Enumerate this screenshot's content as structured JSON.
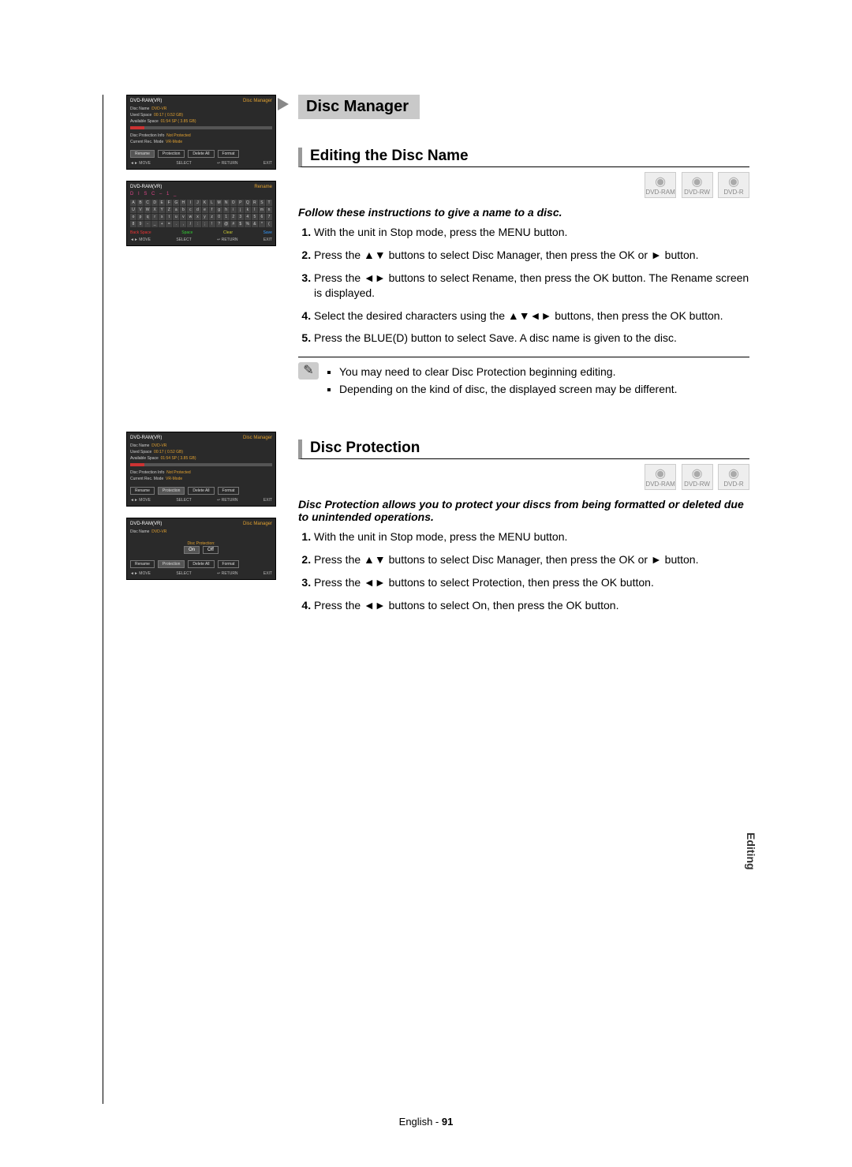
{
  "chapter": "Disc Manager",
  "side_tab": "Editing",
  "icons": {
    "ram": "DVD-RAM",
    "rw": "DVD-RW",
    "r": "DVD-R"
  },
  "section1": {
    "title": "Editing the Disc Name",
    "lead": "Follow these instructions to give a name to a disc.",
    "steps": [
      "With the unit in Stop mode, press the MENU button.",
      "Press the ▲▼ buttons to select Disc Manager, then press the OK or ► button.",
      "Press the ◄► buttons to select Rename, then press the OK button. The Rename screen is displayed.",
      "Select the desired characters using the ▲▼◄► buttons, then press the OK button.",
      "Press the BLUE(D) button to select Save. A disc name is given to the disc."
    ],
    "notes": [
      "You may need to clear Disc Protection beginning editing.",
      "Depending on the kind of disc, the displayed screen may be different."
    ]
  },
  "section2": {
    "title": "Disc Protection",
    "lead": "Disc Protection allows you to protect your discs from being formatted or deleted due to unintended operations.",
    "steps": [
      "With the unit in Stop mode, press the MENU button.",
      "Press the ▲▼ buttons to select Disc Manager, then press the OK or ► button.",
      "Press the ◄► buttons to select Protection, then press the OK button.",
      "Press the ◄► buttons to select On, then press the OK button."
    ]
  },
  "osd": {
    "model": "DVD-RAM(VR)",
    "dm": "Disc Manager",
    "rename": "Rename",
    "disc_name_k": "Disc Name",
    "disc_name_v": "DVD-VR",
    "used_k": "Used Space",
    "used_v": "00:17  ( 0.52 GB)",
    "avail_k": "Available Space",
    "avail_v": "01:54 SP  ( 3.85 GB)",
    "prot_k": "Disc Protection Info",
    "prot_v": "Not Protected",
    "mode_k": "Current Rec. Mode",
    "mode_v": "VR-Mode",
    "tab_rename": "Rename",
    "tab_prot": "Protection",
    "tab_del": "Delete All",
    "tab_fmt": "Format",
    "f_move": "◄► MOVE",
    "f_select": "SELECT",
    "f_return": "↩ RETURN",
    "f_exit": "EXIT",
    "kb_name": "D  I  S  C  –  1  _",
    "btn_back": "Back Space",
    "btn_space": "Space",
    "btn_clear": "Clear",
    "btn_save": "Save",
    "prot_label": "Disc Protection:",
    "on": "On",
    "off": "Off"
  },
  "footer": {
    "lang": "English - ",
    "page": "91"
  }
}
